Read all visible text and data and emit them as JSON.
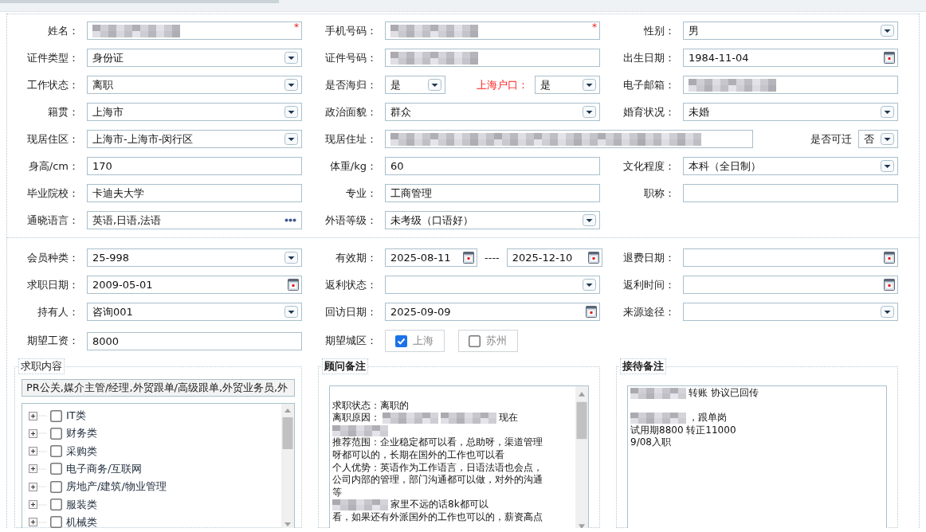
{
  "sections": [
    {
      "rows": [
        [
          {
            "label": "姓名：",
            "kind": "text",
            "redacted": true,
            "required_mark": "*"
          },
          {
            "label": "手机号码：",
            "kind": "text",
            "redacted": true,
            "required_mark": "*"
          },
          {
            "label": "性别：",
            "kind": "select",
            "value": "男"
          }
        ],
        [
          {
            "label": "证件类型：",
            "kind": "select",
            "value": "身份证"
          },
          {
            "label": "证件号码：",
            "kind": "text",
            "redacted": true
          },
          {
            "label": "出生日期：",
            "kind": "date",
            "value": "1984-11-04"
          }
        ],
        [
          {
            "label": "工作状态：",
            "kind": "select",
            "value": "离职"
          },
          {
            "label": "是否海归：",
            "kind": "select",
            "value": "是",
            "extra": {
              "label": "上海户口：",
              "emphasis": true,
              "kind": "select",
              "value": "是"
            }
          },
          {
            "label": "电子邮箱：",
            "kind": "text",
            "redacted": true
          }
        ],
        [
          {
            "label": "籍贯：",
            "kind": "select",
            "value": "上海市"
          },
          {
            "label": "政治面貌：",
            "kind": "select",
            "value": "群众"
          },
          {
            "label": "婚育状况：",
            "kind": "select",
            "value": "未婚"
          }
        ],
        [
          {
            "label": "现居住区：",
            "kind": "select",
            "value": "上海市-上海市-闵行区"
          },
          {
            "label": "现居住址：",
            "kind": "text",
            "redacted": true,
            "extra": {
              "label": "是否可迁",
              "emphasis": false,
              "kind": "select",
              "value": "否"
            }
          }
        ],
        [
          {
            "label": "身高/cm：",
            "kind": "text",
            "value": "170"
          },
          {
            "label": "体重/kg：",
            "kind": "text",
            "value": "60"
          },
          {
            "label": "文化程度：",
            "kind": "select",
            "value": "本科（全日制）"
          }
        ],
        [
          {
            "label": "毕业院校：",
            "kind": "text",
            "value": "卡迪夫大学"
          },
          {
            "label": "专业：",
            "kind": "text",
            "value": "工商管理"
          },
          {
            "label": "职称：",
            "kind": "text"
          }
        ],
        [
          {
            "label": "通晓语言：",
            "kind": "picker",
            "value": "英语,日语,法语"
          },
          {
            "label": "外语等级：",
            "kind": "select",
            "value": "未考级（口语好）"
          }
        ]
      ]
    },
    {
      "rows": [
        [
          {
            "label": "会员种类：",
            "kind": "select",
            "value": "25-998"
          },
          {
            "label": "有效期：",
            "kind": "daterange",
            "from": "2025-08-11",
            "separator": "----",
            "to": "2025-12-10"
          },
          {
            "label": "退费日期：",
            "kind": "date"
          }
        ],
        [
          {
            "label": "求职日期：",
            "kind": "date",
            "value": "2009-05-01"
          },
          {
            "label": "返利状态：",
            "kind": "select"
          },
          {
            "label": "返利时间：",
            "kind": "date"
          }
        ],
        [
          {
            "label": "持有人：",
            "kind": "select",
            "value": "咨询001"
          },
          {
            "label": "回访日期：",
            "kind": "date",
            "value": "2025-09-09"
          },
          {
            "label": "来源途径：",
            "kind": "select"
          }
        ],
        [
          {
            "label": "期望工资：",
            "kind": "text",
            "value": "8000"
          },
          {
            "label": "期望城区：",
            "kind": "checks",
            "options": [
              {
                "label": "上海",
                "checked": true
              },
              {
                "label": "苏州",
                "checked": false
              }
            ]
          }
        ]
      ]
    }
  ],
  "panels": [
    {
      "title": "求职内容",
      "emphasis": false,
      "kind": "tree",
      "summary": "PR公关,媒介主管/经理,外贸跟单/高级跟单,外贸业务员,外",
      "items": [
        {
          "label": "IT类",
          "expanded": false,
          "checked": false
        },
        {
          "label": "财务类",
          "expanded": false,
          "checked": false
        },
        {
          "label": "采购类",
          "expanded": false,
          "checked": false
        },
        {
          "label": "电子商务/互联网",
          "expanded": false,
          "checked": false
        },
        {
          "label": "房地产/建筑/物业管理",
          "expanded": false,
          "checked": false
        },
        {
          "label": "服装类",
          "expanded": false,
          "checked": false
        },
        {
          "label": "机械类",
          "expanded": false,
          "checked": false
        }
      ]
    },
    {
      "title": "顾问备注",
      "emphasis": true,
      "kind": "notes",
      "scrollable": true,
      "lines": [
        {
          "blank": true
        },
        {
          "segments": [
            {
              "kind": "text",
              "text": "求职状态：离职的"
            }
          ]
        },
        {
          "segments": [
            {
              "kind": "text",
              "text": "离职原因："
            },
            {
              "kind": "redacted"
            },
            {
              "kind": "redacted"
            },
            {
              "kind": "text",
              "text": "现在"
            }
          ]
        },
        {
          "segments": [
            {
              "kind": "redacted"
            }
          ]
        },
        {
          "segments": [
            {
              "kind": "text",
              "text": "推荐范围：企业稳定都可以看，总助呀，渠道管理"
            }
          ]
        },
        {
          "segments": [
            {
              "kind": "text",
              "text": "呀都可以的，长期在国外的工作也可以看"
            }
          ]
        },
        {
          "segments": [
            {
              "kind": "text",
              "text": "个人优势：英语作为工作语言，日语法语也会点，"
            }
          ]
        },
        {
          "segments": [
            {
              "kind": "text",
              "text": "公司内部的管理，部门沟通都可以做，对外的沟通"
            }
          ]
        },
        {
          "segments": [
            {
              "kind": "text",
              "text": "等"
            }
          ]
        },
        {
          "segments": [
            {
              "kind": "redacted"
            },
            {
              "kind": "text",
              "text": "家里不远的话8k都可以"
            }
          ]
        },
        {
          "segments": [
            {
              "kind": "text",
              "text": "看，如果还有外派国外的工作也可以的，薪资高点"
            }
          ]
        }
      ]
    },
    {
      "title": "接待备注",
      "emphasis": true,
      "kind": "notes",
      "scrollable": false,
      "lines": [
        {
          "segments": [
            {
              "kind": "redacted"
            },
            {
              "kind": "text",
              "text": "转账 协议已回传"
            }
          ]
        },
        {
          "blank": true
        },
        {
          "segments": [
            {
              "kind": "redacted"
            },
            {
              "kind": "text",
              "text": "，跟单岗"
            }
          ]
        },
        {
          "segments": [
            {
              "kind": "text",
              "text": "试用期8800 转正11000"
            }
          ]
        },
        {
          "segments": [
            {
              "kind": "text",
              "text": "9/08入职"
            }
          ]
        }
      ]
    }
  ]
}
